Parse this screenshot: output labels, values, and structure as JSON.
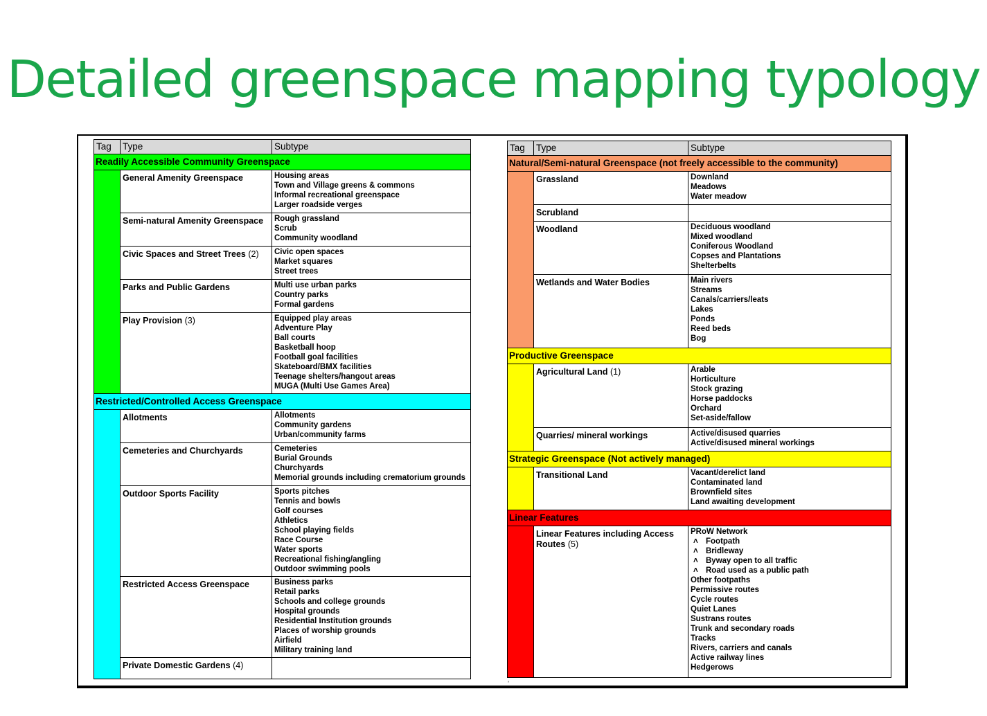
{
  "page": {
    "title": "Detailed greenspace mapping typology",
    "title_color": "#1aa64b"
  },
  "columns": {
    "tag": "Tag",
    "type": "Type",
    "subtype": "Subtype"
  },
  "left_table": {
    "sections": [
      {
        "heading": "Readily Accessible Community Greenspace",
        "color": "#00ff00",
        "rows": [
          {
            "type": "General Amenity Greenspace",
            "note": "",
            "subtypes": [
              "Housing areas",
              "Town and Village greens & commons",
              "Informal recreational greenspace",
              "Larger roadside verges"
            ]
          },
          {
            "type": "Semi-natural Amenity Greenspace",
            "note": "",
            "subtypes": [
              "Rough grassland",
              "Scrub",
              "Community woodland"
            ]
          },
          {
            "type": "Civic Spaces and Street Trees",
            "note": "(2)",
            "subtypes": [
              "Civic open spaces",
              "Market  squares",
              "Street trees"
            ]
          },
          {
            "type": "Parks and Public Gardens",
            "note": "",
            "subtypes": [
              "Multi use urban parks",
              "Country parks",
              "Formal gardens"
            ]
          },
          {
            "type": "Play Provision",
            "note": "(3)",
            "subtypes": [
              "Equipped play areas",
              "Adventure Play",
              "Ball courts",
              "Basketball hoop",
              "Football goal facilities",
              "Skateboard/BMX facilities",
              "Teenage shelters/hangout areas",
              "MUGA (Multi Use Games Area)"
            ]
          }
        ]
      },
      {
        "heading": "Restricted/Controlled Access Greenspace",
        "color": "#00ffff",
        "rows": [
          {
            "type": "Allotments",
            "note": "",
            "subtypes": [
              "Allotments",
              "Community gardens",
              "Urban/community farms"
            ]
          },
          {
            "type": "Cemeteries and Churchyards",
            "note": "",
            "subtypes": [
              "Cemeteries",
              "Burial Grounds",
              "Churchyards",
              "Memorial grounds including crematorium grounds"
            ]
          },
          {
            "type": "Outdoor Sports Facility",
            "note": "",
            "subtypes": [
              "Sports pitches",
              "Tennis and bowls",
              "Golf courses",
              "Athletics",
              "School playing fields",
              "Race Course",
              "Water sports",
              "Recreational fishing/angling",
              "Outdoor swimming pools"
            ]
          },
          {
            "type": "Restricted Access Greenspace",
            "note": "",
            "subtypes": [
              "Business parks",
              "Retail parks",
              "Schools and college grounds",
              "Hospital grounds",
              "Residential Institution grounds",
              "Places of worship grounds",
              "Airfield",
              "Military training land"
            ]
          },
          {
            "type": "Private Domestic Gardens",
            "note": "(4)",
            "subtypes": []
          }
        ]
      }
    ]
  },
  "right_table": {
    "sections": [
      {
        "heading": "Natural/Semi-natural Greenspace (not freely accessible to the community)",
        "color": "#fa9a6a",
        "rows": [
          {
            "type": "Grassland",
            "note": "",
            "subtypes": [
              "Downland",
              "Meadows",
              "Water meadow"
            ]
          },
          {
            "type": "Scrubland",
            "note": "",
            "subtypes": []
          },
          {
            "type": "Woodland",
            "note": "",
            "subtypes": [
              "Deciduous woodland",
              "Mixed woodland",
              "Coniferous Woodland",
              "Copses and Plantations",
              "Shelterbelts"
            ]
          },
          {
            "type": "Wetlands and Water Bodies",
            "note": "",
            "subtypes": [
              "Main rivers",
              "Streams",
              "Canals/carriers/leats",
              "Lakes",
              "Ponds",
              "Reed beds",
              "Bog"
            ]
          }
        ]
      },
      {
        "heading": "Productive Greenspace",
        "color": "#ffff00",
        "rows": [
          {
            "type": "Agricultural Land",
            "note": "(1)",
            "subtypes": [
              "Arable",
              "Horticulture",
              "Stock grazing",
              "Horse paddocks",
              "Orchard",
              "Set-aside/fallow"
            ]
          },
          {
            "type": "Quarries/ mineral workings",
            "note": "",
            "subtypes": [
              "Active/disused quarries",
              "Active/disused mineral workings"
            ]
          }
        ]
      },
      {
        "heading": "Strategic Greenspace  (Not actively managed)",
        "color": "#ffff00",
        "rows": [
          {
            "type": "Transitional Land",
            "note": "",
            "subtypes": [
              "Vacant/derelict land",
              "Contaminated land",
              "Brownfield sites",
              "Land awaiting development"
            ]
          }
        ]
      },
      {
        "heading": "Linear Features",
        "color": "#ff0000",
        "rows": [
          {
            "type": "Linear  Features including Access Routes",
            "note": "(5)",
            "subtypes": [
              "PRoW Network",
              ">Footpath",
              ">Bridleway",
              ">Byway open to all traffic",
              ">Road used as a public path",
              "Other footpaths",
              "Permissive routes",
              "Cycle routes",
              "Quiet Lanes",
              "Sustrans routes",
              "Trunk and secondary roads",
              "Tracks",
              "Rivers, carriers and canals",
              "Active railway lines",
              "Hedgerows"
            ]
          }
        ]
      }
    ]
  }
}
